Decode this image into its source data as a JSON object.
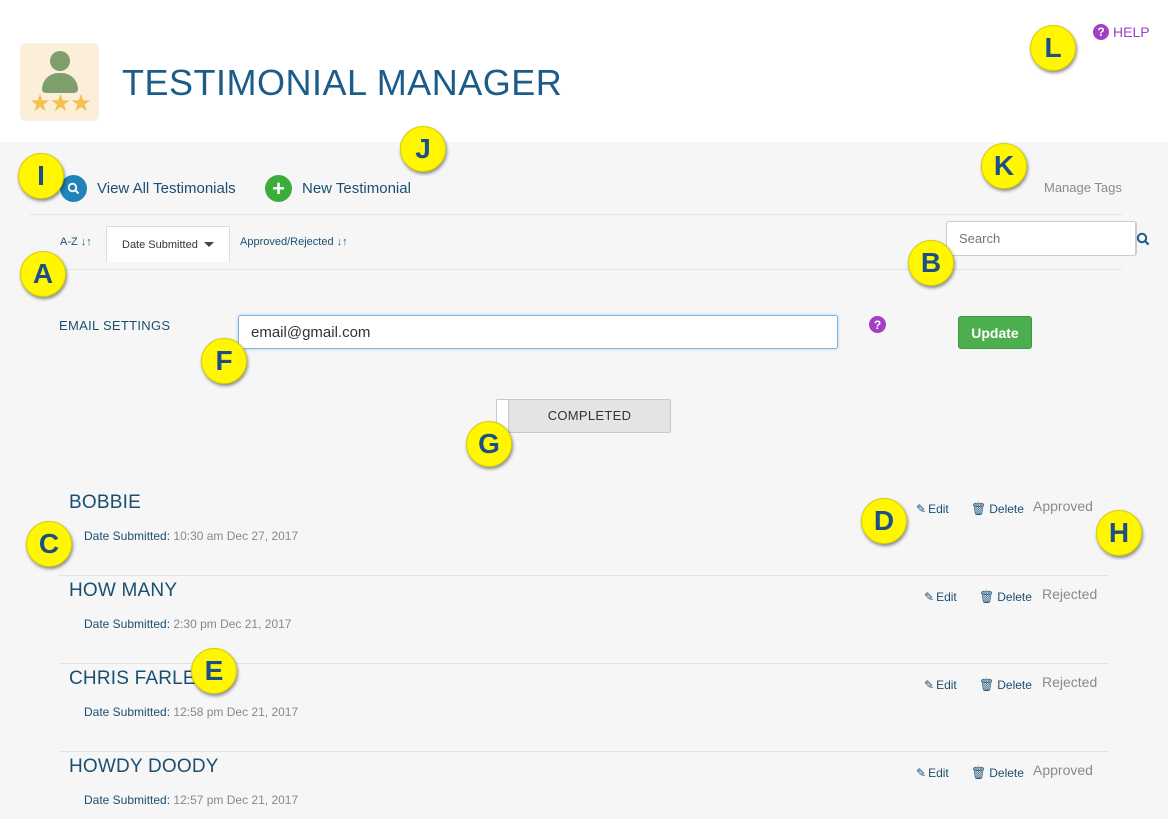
{
  "app": {
    "title": "TESTIMONIAL MANAGER",
    "help_label": "HELP"
  },
  "actions": {
    "view_all": "View All Testimonials",
    "new": "New Testimonial",
    "manage_tags": "Manage Tags"
  },
  "sort_tabs": {
    "az": "A-Z",
    "date": "Date Submitted",
    "status": "Approved/Rejected"
  },
  "search": {
    "placeholder": "Search"
  },
  "email_settings": {
    "label": "EMAIL SETTINGS",
    "value": "email@gmail.com",
    "update_label": "Update"
  },
  "filter_toggle": {
    "label": "COMPLETED"
  },
  "row_labels": {
    "edit": "Edit",
    "delete": "Delete",
    "date_label": "Date Submitted:"
  },
  "testimonials": [
    {
      "name": "BOBBIE",
      "date": "10:30 am Dec 27, 2017",
      "status": "Approved"
    },
    {
      "name": "HOW MANY",
      "date": "2:30 pm Dec 21, 2017",
      "status": "Rejected"
    },
    {
      "name": "CHRIS FARLEY",
      "date": "12:58 pm Dec 21, 2017",
      "status": "Rejected"
    },
    {
      "name": "HOWDY DOODY",
      "date": "12:57 pm Dec 21, 2017",
      "status": "Approved"
    }
  ],
  "markers": [
    "A",
    "B",
    "C",
    "D",
    "E",
    "F",
    "G",
    "H",
    "I",
    "J",
    "K",
    "L"
  ],
  "colors": {
    "brand_blue": "#1b5c8a",
    "accent_purple": "#a23fc4",
    "success_green": "#4cae4c",
    "marker_yellow": "#fff600"
  }
}
